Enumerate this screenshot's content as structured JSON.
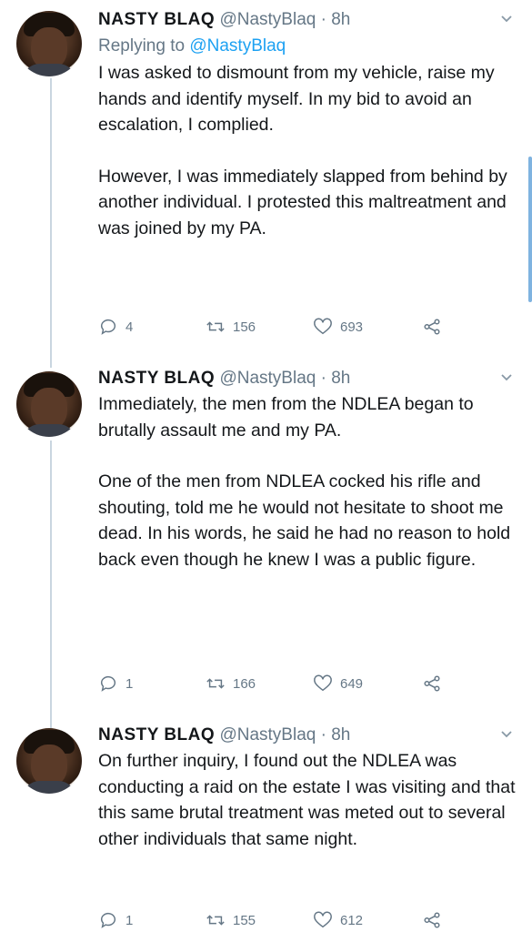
{
  "tweets": [
    {
      "name": "NASTY BLAQ",
      "handle": "@NastyBlaq",
      "time": "· 8h",
      "replying_prefix": "Replying to",
      "replying_to": "@NastyBlaq",
      "paragraphs": [
        "I was asked to dismount from my vehicle, raise my hands and identify myself. In my bid to avoid an escalation, I complied.",
        "However, I was immediately slapped from behind by another individual. I protested this maltreatment and was joined by my PA."
      ],
      "replies": "4",
      "retweets": "156",
      "likes": "693"
    },
    {
      "name": "NASTY BLAQ",
      "handle": "@NastyBlaq",
      "time": "· 8h",
      "paragraphs": [
        "Immediately, the men from the NDLEA began to brutally assault me and my PA.",
        "One of the men from NDLEA cocked his rifle and shouting, told me he would not hesitate to shoot me dead. In his words, he said he had no reason to hold back even though he knew I was a public figure."
      ],
      "replies": "1",
      "retweets": "166",
      "likes": "649"
    },
    {
      "name": "NASTY BLAQ",
      "handle": "@NastyBlaq",
      "time": "· 8h",
      "paragraphs": [
        "On further inquiry, I found out the NDLEA was conducting a raid on the estate I was visiting and that this same brutal treatment was meted out to several other individuals that same night."
      ],
      "replies": "1",
      "retweets": "155",
      "likes": "612"
    }
  ],
  "colors": {
    "text": "#14171a",
    "secondary": "#657786",
    "link": "#1da1f2",
    "thread": "#c9d6e0"
  },
  "icons": [
    "chevron-down-icon",
    "reply-icon",
    "retweet-icon",
    "like-icon",
    "share-icon"
  ]
}
